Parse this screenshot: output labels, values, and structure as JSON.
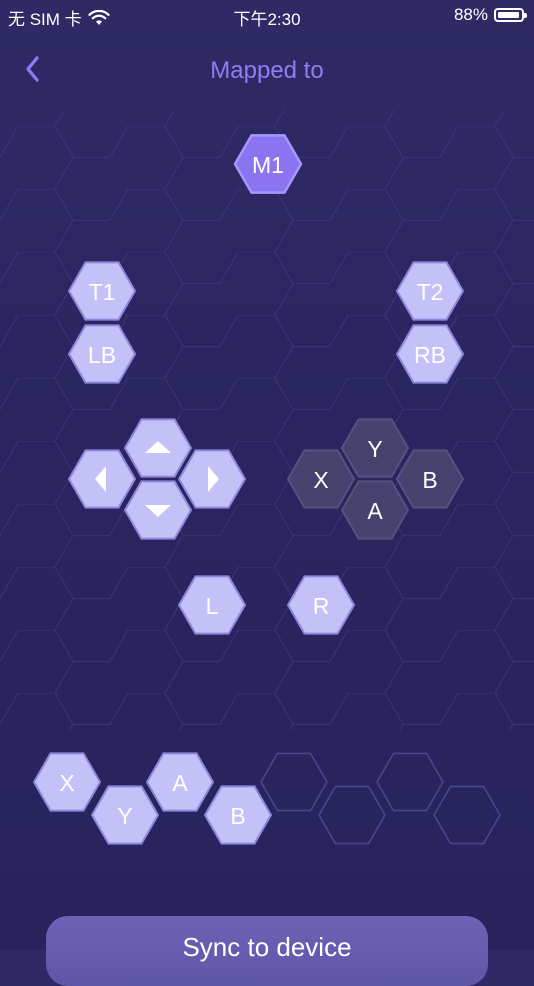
{
  "status_bar": {
    "carrier": "无 SIM 卡",
    "time": "下午2:30",
    "battery": "88%",
    "battery_level": 0.88
  },
  "header": {
    "title": "Mapped to",
    "back_icon": "chevron-left-icon"
  },
  "controls": {
    "m1": "M1",
    "t1": "T1",
    "t2": "T2",
    "lb": "LB",
    "rb": "RB",
    "dpad_up_icon": "triangle-up-icon",
    "dpad_down_icon": "triangle-down-icon",
    "dpad_left_icon": "triangle-left-icon",
    "dpad_right_icon": "triangle-right-icon",
    "face_y": "Y",
    "face_x": "X",
    "face_b": "B",
    "face_a": "A",
    "l": "L",
    "r": "R"
  },
  "sequence": [
    "X",
    "Y",
    "A",
    "B"
  ],
  "sync_button": "Sync to device",
  "colors": {
    "accent": "#8f7cf2",
    "m1_fill": "#8b74f0",
    "key_fill": "#c4c1f8",
    "face_fill": "#45426e"
  }
}
